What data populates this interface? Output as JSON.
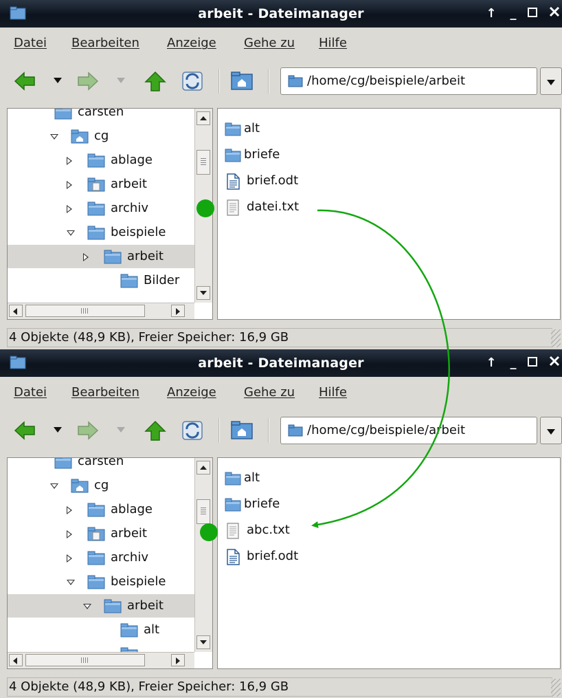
{
  "colors": {
    "titlebar": "#0c131d",
    "window_bg": "#dcdad5",
    "selection": "#d8d6d3",
    "folder_blue": "#4a8fd0",
    "annotation_green": "#13a70f"
  },
  "windows": [
    {
      "title": "arbeit - Dateimanager",
      "window_buttons": {
        "up": "↑",
        "minimize": "_"
      },
      "menu": [
        "Datei",
        "Bearbeiten",
        "Anzeige",
        "Gehe zu",
        "Hilfe"
      ],
      "toolbar": {
        "icons": [
          "back-icon",
          "forward-icon",
          "up-icon",
          "refresh-icon",
          "home-icon"
        ]
      },
      "path": "/home/cg/beispiele/arbeit",
      "tree": [
        {
          "label": "carsten",
          "expander": "none",
          "icon": "folder-icon",
          "selected": false
        },
        {
          "label": "cg",
          "expander": "open",
          "icon": "home-folder-icon",
          "selected": false
        },
        {
          "label": "ablage",
          "expander": "closed",
          "icon": "folder-icon",
          "selected": false
        },
        {
          "label": "arbeit",
          "expander": "closed",
          "icon": "document-folder-icon",
          "selected": false
        },
        {
          "label": "archiv",
          "expander": "closed",
          "icon": "folder-icon",
          "selected": false
        },
        {
          "label": "beispiele",
          "expander": "open",
          "icon": "folder-icon",
          "selected": false
        },
        {
          "label": "arbeit",
          "expander": "closed",
          "icon": "folder-icon",
          "selected": true
        },
        {
          "label": "Bilder",
          "expander": "none",
          "icon": "folder-icon",
          "selected": false
        }
      ],
      "files": [
        {
          "name": "alt",
          "type": "folder"
        },
        {
          "name": "briefe",
          "type": "folder"
        },
        {
          "name": "brief.odt",
          "type": "document"
        },
        {
          "name": "datei.txt",
          "type": "text"
        }
      ],
      "status": "4 Objekte (48,9 KB), Freier Speicher: 16,9 GB"
    },
    {
      "title": "arbeit - Dateimanager",
      "window_buttons": {
        "up": "↑",
        "minimize": "_"
      },
      "menu": [
        "Datei",
        "Bearbeiten",
        "Anzeige",
        "Gehe zu",
        "Hilfe"
      ],
      "toolbar": {
        "icons": [
          "back-icon",
          "forward-icon",
          "up-icon",
          "refresh-icon",
          "home-icon"
        ]
      },
      "path": "/home/cg/beispiele/arbeit",
      "tree": [
        {
          "label": "carsten",
          "expander": "none",
          "icon": "folder-icon",
          "selected": false
        },
        {
          "label": "cg",
          "expander": "open",
          "icon": "home-folder-icon",
          "selected": false
        },
        {
          "label": "ablage",
          "expander": "closed",
          "icon": "folder-icon",
          "selected": false
        },
        {
          "label": "arbeit",
          "expander": "closed",
          "icon": "document-folder-icon",
          "selected": false
        },
        {
          "label": "archiv",
          "expander": "closed",
          "icon": "folder-icon",
          "selected": false
        },
        {
          "label": "beispiele",
          "expander": "open",
          "icon": "folder-icon",
          "selected": false
        },
        {
          "label": "arbeit",
          "expander": "open",
          "icon": "folder-icon",
          "selected": true
        },
        {
          "label": "alt",
          "expander": "none",
          "icon": "folder-icon",
          "selected": false
        },
        {
          "label": "",
          "expander": "none",
          "icon": "folder-icon",
          "selected": false
        }
      ],
      "files": [
        {
          "name": "alt",
          "type": "folder"
        },
        {
          "name": "briefe",
          "type": "folder"
        },
        {
          "name": "abc.txt",
          "type": "text"
        },
        {
          "name": "brief.odt",
          "type": "document"
        }
      ],
      "status": "4 Objekte (48,9 KB), Freier Speicher: 16,9 GB"
    }
  ],
  "annotation": {
    "from": "datei.txt",
    "to": "abc.txt",
    "meaning": "rename-arrow"
  }
}
